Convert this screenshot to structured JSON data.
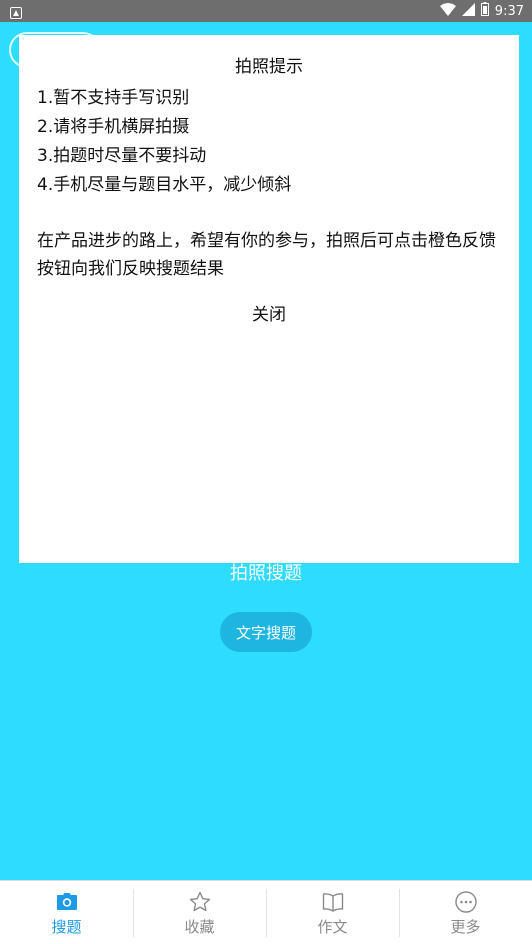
{
  "status_bar": {
    "time": "9:37",
    "icons": [
      "notification-icon",
      "wifi-icon",
      "signal-icon",
      "battery-icon"
    ]
  },
  "main": {
    "photo_search_label": "拍照搜题",
    "text_search_button": "文字搜题",
    "background_color": "#2ddcff"
  },
  "dialog": {
    "title": "拍照提示",
    "tips": [
      "1.暂不支持手写识别",
      "2.请将手机横屏拍摄",
      "3.拍题时尽量不要抖动",
      "4.手机尽量与题目水平，减少倾斜"
    ],
    "description": "在产品进步的路上，希望有你的参与，拍照后可点击橙色反馈按钮向我们反映搜题结果",
    "close_label": "关闭"
  },
  "bottom_nav": {
    "items": [
      {
        "label": "搜题",
        "icon": "camera-icon",
        "active": true
      },
      {
        "label": "收藏",
        "icon": "star-icon",
        "active": false
      },
      {
        "label": "作文",
        "icon": "book-icon",
        "active": false
      },
      {
        "label": "更多",
        "icon": "more-icon",
        "active": false
      }
    ],
    "active_color": "#1e9be6"
  }
}
